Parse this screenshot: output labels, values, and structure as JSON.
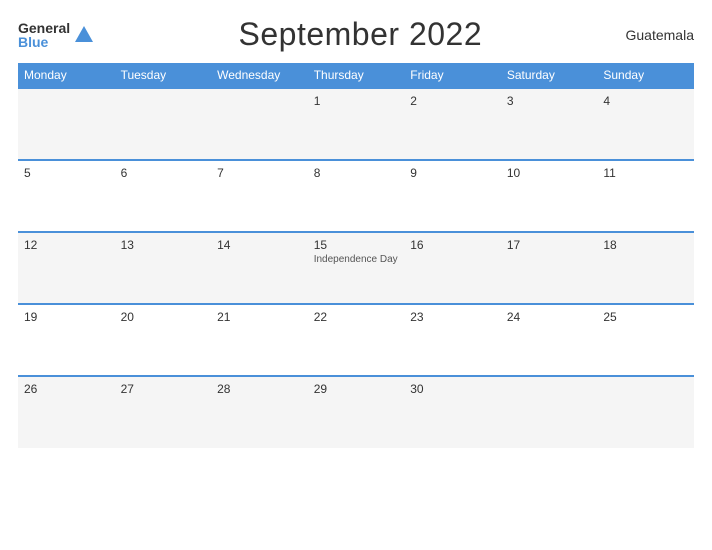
{
  "header": {
    "logo_general": "General",
    "logo_blue": "Blue",
    "title": "September 2022",
    "country": "Guatemala"
  },
  "days_of_week": [
    "Monday",
    "Tuesday",
    "Wednesday",
    "Thursday",
    "Friday",
    "Saturday",
    "Sunday"
  ],
  "weeks": [
    [
      {
        "day": "",
        "event": ""
      },
      {
        "day": "",
        "event": ""
      },
      {
        "day": "",
        "event": ""
      },
      {
        "day": "1",
        "event": ""
      },
      {
        "day": "2",
        "event": ""
      },
      {
        "day": "3",
        "event": ""
      },
      {
        "day": "4",
        "event": ""
      }
    ],
    [
      {
        "day": "5",
        "event": ""
      },
      {
        "day": "6",
        "event": ""
      },
      {
        "day": "7",
        "event": ""
      },
      {
        "day": "8",
        "event": ""
      },
      {
        "day": "9",
        "event": ""
      },
      {
        "day": "10",
        "event": ""
      },
      {
        "day": "11",
        "event": ""
      }
    ],
    [
      {
        "day": "12",
        "event": ""
      },
      {
        "day": "13",
        "event": ""
      },
      {
        "day": "14",
        "event": ""
      },
      {
        "day": "15",
        "event": "Independence Day"
      },
      {
        "day": "16",
        "event": ""
      },
      {
        "day": "17",
        "event": ""
      },
      {
        "day": "18",
        "event": ""
      }
    ],
    [
      {
        "day": "19",
        "event": ""
      },
      {
        "day": "20",
        "event": ""
      },
      {
        "day": "21",
        "event": ""
      },
      {
        "day": "22",
        "event": ""
      },
      {
        "day": "23",
        "event": ""
      },
      {
        "day": "24",
        "event": ""
      },
      {
        "day": "25",
        "event": ""
      }
    ],
    [
      {
        "day": "26",
        "event": ""
      },
      {
        "day": "27",
        "event": ""
      },
      {
        "day": "28",
        "event": ""
      },
      {
        "day": "29",
        "event": ""
      },
      {
        "day": "30",
        "event": ""
      },
      {
        "day": "",
        "event": ""
      },
      {
        "day": "",
        "event": ""
      }
    ]
  ]
}
